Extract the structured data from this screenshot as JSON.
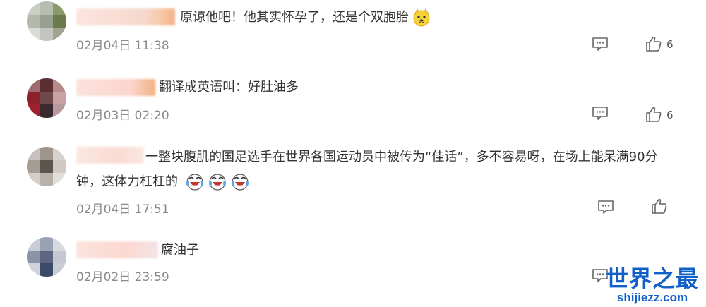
{
  "comments": [
    {
      "text": "原谅他吧！他其实怀孕了，还是个双胞胎",
      "emoji": "dog-face-emoji",
      "date": "02月04日",
      "time": "11:38",
      "likes": "6",
      "avatar_colors": [
        "#c9cfc4",
        "#b7bdb0",
        "#8a9a6a",
        "#b3b8ad",
        "#9aa08f",
        "#6b7b4c",
        "#d8dbd6",
        "#c3c6c0",
        "#a0a58f"
      ],
      "username_colors": [
        "#f6d8cc",
        "#f7c9a8"
      ]
    },
    {
      "text": "翻译成英语叫：好肚油多",
      "date": "02月03日",
      "time": "02:20",
      "likes": "6",
      "avatar_colors": [
        "#9e6b6e",
        "#5c2e33",
        "#b38b8b",
        "#8f1f2a",
        "#6e4a4f",
        "#c9a3a3",
        "#a02030",
        "#3a2a2d",
        "#b99a9c"
      ],
      "username_colors": [
        "#fbd5cc",
        "#f4b184"
      ]
    },
    {
      "text_line1": "一整块腹肌的国足选手在世界各国运动员中被传为“佳话”，多不容易呀，在场上能呆满90分",
      "text_line2": "钟，这体力杠杠的",
      "date": "02月04日",
      "time": "17:51",
      "avatar_colors": [
        "#c7c2bd",
        "#9e958c",
        "#d6d1cb",
        "#a59c94",
        "#5b5550",
        "#cfc9c3",
        "#d3cec9",
        "#b8b1ab",
        "#e2dfdb"
      ],
      "username_colors": [
        "#fadbd2",
        "#fbe7e1"
      ]
    },
    {
      "text": "腐油子",
      "date": "02月02日",
      "time": "23:59",
      "avatar_colors": [
        "#c8ccd6",
        "#9aa3b5",
        "#d7dae1",
        "#8a93a8",
        "#5c6680",
        "#c4c8d2",
        "#d0d3da",
        "#3c4a6a",
        "#c8ccd3"
      ],
      "username_colors": [
        "#fbd8d0",
        "#f3e4e6"
      ]
    }
  ],
  "watermark": {
    "logo": "世界之最",
    "url": "shijiezz.com"
  },
  "icons": {
    "reply": "comment-icon",
    "like": "thumbs-up-icon",
    "emoji_laugh": "laughing-face-emoji"
  },
  "colors": {
    "text": "#333333",
    "meta": "#8a8a8a",
    "watermark": "#1060c8"
  }
}
